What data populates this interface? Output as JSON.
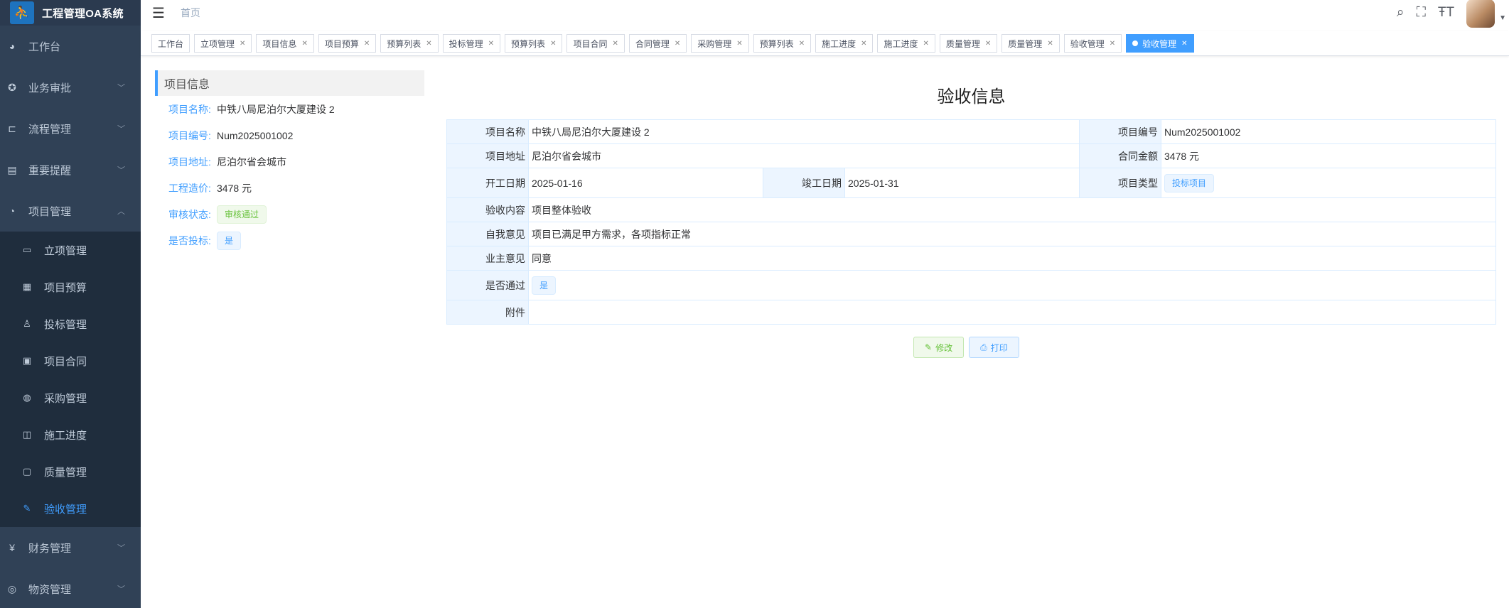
{
  "app": {
    "title": "工程管理OA系统"
  },
  "sidebar": {
    "items": [
      {
        "label": "工作台",
        "icon": "dashboard-icon"
      },
      {
        "label": "业务审批",
        "icon": "approval-icon"
      },
      {
        "label": "流程管理",
        "icon": "flow-icon"
      },
      {
        "label": "重要提醒",
        "icon": "reminder-icon"
      },
      {
        "label": "项目管理",
        "icon": "project-icon"
      }
    ],
    "project_sub": [
      "立项管理",
      "项目预算",
      "投标管理",
      "项目合同",
      "采购管理",
      "施工进度",
      "质量管理",
      "验收管理"
    ],
    "bottom_items": [
      {
        "label": "财务管理",
        "icon": "yen-icon"
      },
      {
        "label": "物资管理",
        "icon": "material-icon"
      }
    ]
  },
  "header": {
    "breadcrumb": "首页"
  },
  "tabs": [
    {
      "label": "工作台"
    },
    {
      "label": "立项管理"
    },
    {
      "label": "项目信息"
    },
    {
      "label": "项目预算"
    },
    {
      "label": "预算列表"
    },
    {
      "label": "投标管理"
    },
    {
      "label": "预算列表"
    },
    {
      "label": "项目合同"
    },
    {
      "label": "合同管理"
    },
    {
      "label": "采购管理"
    },
    {
      "label": "预算列表"
    },
    {
      "label": "施工进度"
    },
    {
      "label": "施工进度"
    },
    {
      "label": "质量管理"
    },
    {
      "label": "质量管理"
    },
    {
      "label": "验收管理"
    },
    {
      "label": "验收管理"
    }
  ],
  "info": {
    "header": "项目信息",
    "name_label": "项目名称:",
    "name": "中铁八局尼泊尔大厦建设 2",
    "code_label": "项目编号:",
    "code": "Num2025001002",
    "address_label": "项目地址:",
    "address": "尼泊尔省会城市",
    "cost_label": "工程造价:",
    "cost": "3478 元",
    "status_label": "审核状态:",
    "status": "审核通过",
    "bid_label": "是否投标:",
    "bid": "是"
  },
  "detail": {
    "title": "验收信息",
    "project_name_label": "项目名称",
    "project_name": "中铁八局尼泊尔大厦建设 2",
    "project_code_label": "项目编号",
    "project_code": "Num2025001002",
    "address_label": "项目地址",
    "address": "尼泊尔省会城市",
    "amount_label": "合同金额",
    "amount": "3478 元",
    "start_label": "开工日期",
    "start": "2025-01-16",
    "end_label": "竣工日期",
    "end": "2025-01-31",
    "type_label": "项目类型",
    "type": "投标项目",
    "content_label": "验收内容",
    "content": "项目整体验收",
    "self_label": "自我意见",
    "self": "项目已满足甲方需求，各项指标正常",
    "owner_label": "业主意见",
    "owner": "同意",
    "pass_label": "是否通过",
    "pass": "是",
    "attach_label": "附件",
    "attach": ""
  },
  "buttons": {
    "edit": "修改",
    "print": "打印"
  },
  "colors": {
    "sidebar": "#304156",
    "accent": "#409eff",
    "success": "#67c23a"
  }
}
